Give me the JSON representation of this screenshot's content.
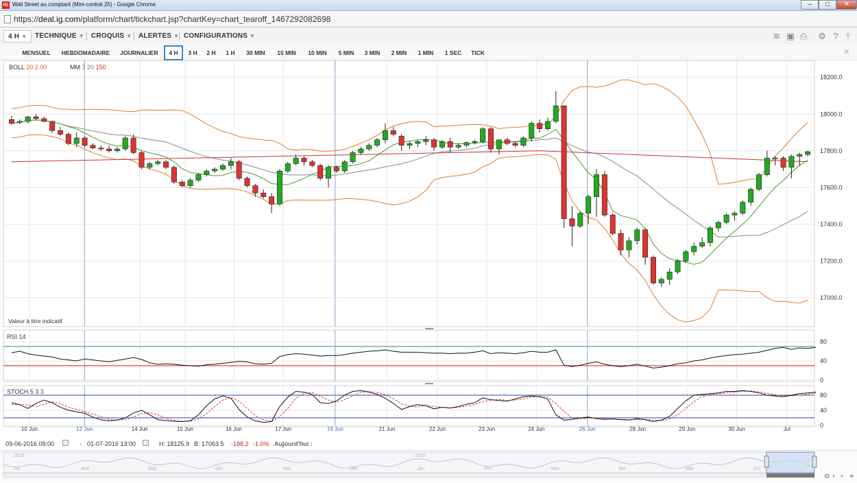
{
  "window": {
    "title": "Wall Street au comptant (Mini-contrat 25) - Google Chrome",
    "app_icon_text": "IG",
    "min": "–",
    "max": "□",
    "close": "✕"
  },
  "address": {
    "scheme": "https://",
    "host": "deal.ig.com",
    "path": "/platform/chart/tickchart.jsp?chartKey=chart_tearoff_1467292082698"
  },
  "toolbar": {
    "period": "4 H",
    "technique": "TECHNIQUE",
    "croquis": "CROQUIS",
    "alertes": "ALERTES",
    "configurations": "CONFIGURATIONS"
  },
  "timeframes": [
    "MENSUEL",
    "HEBDOMADAIRE",
    "JOURNALIER",
    "4 H",
    "3 H",
    "2 H",
    "1 H",
    "30 MIN",
    "15 MIN",
    "10 MIN",
    "5 MIN",
    "3 MIN",
    "2 MIN",
    "1 MIN",
    "1 SEC",
    "TICK"
  ],
  "selected_timeframe": "4 H",
  "indicators": {
    "boll_name": "BOLL",
    "boll_p1": "20",
    "boll_p2": "2.00",
    "mm_name": "MM",
    "mm_p1": "7",
    "mm_p2": "20",
    "mm_p3": "150",
    "rsi_name": "RSI",
    "rsi_p": "14",
    "stoch_name": "STOCH",
    "stoch_p1": "5",
    "stoch_p2": "3",
    "stoch_p3": "3",
    "note": "Valeur à titre indicatif"
  },
  "colors": {
    "up": "#22aa22",
    "down": "#dd3333",
    "boll": "#e07b2a",
    "mm7": "#4a9a2a",
    "mm20": "#888888",
    "mm150": "#cc3333",
    "rsi_hi": "#4aa7a0",
    "rsi_lo": "#e04040",
    "stoch_k": "#111111",
    "stoch_d": "#dd3333",
    "stoch_lines": "#3344aa",
    "grid": "#e6e6e6"
  },
  "footer": {
    "start": "09-06-2016 09:00",
    "dash": "-",
    "end": "01-07-2016 13:00",
    "high": "H: 18125.9",
    "low": "B: 17063.5",
    "change": "-188.2",
    "change_pct": "-1.0%",
    "today": "Aujourd'hui :"
  },
  "navigator": {
    "years": [
      "2015",
      "2016"
    ],
    "months": [
      "Jul",
      "Aoû",
      "Sep",
      "Oct",
      "Nov",
      "Déc",
      "Jan",
      "Fév",
      "Mar",
      "Avr",
      "Mai",
      "Jun"
    ]
  },
  "chart_data": {
    "type": "candlestick",
    "price_ticks": [
      "18200.0",
      "18000.0",
      "17800.0",
      "17600.0",
      "17400.0",
      "17200.0",
      "17000.0"
    ],
    "rsi_ticks": [
      "80",
      "40",
      "0"
    ],
    "stoch_ticks": [
      "80",
      "40",
      "0"
    ],
    "x_labels": [
      "10 Jun",
      "12 Jun",
      "14 Jun",
      "15 Jun",
      "16 Jun",
      "17 Jun",
      "19 Jun",
      "21 Jun",
      "22 Jun",
      "23 Jun",
      "24 Jun",
      "26 Jun",
      "28 Jun",
      "29 Jun",
      "30 Jun",
      "Jul"
    ],
    "ylim": [
      16850,
      18270
    ],
    "candles": [
      [
        17970,
        17990,
        17940,
        17950
      ],
      [
        17955,
        17970,
        17945,
        17960
      ],
      [
        17960,
        17990,
        17950,
        17985
      ],
      [
        17985,
        18000,
        17970,
        17975
      ],
      [
        17975,
        17985,
        17955,
        17960
      ],
      [
        17960,
        17965,
        17900,
        17910
      ],
      [
        17910,
        17930,
        17880,
        17890
      ],
      [
        17890,
        17900,
        17830,
        17840
      ],
      [
        17840,
        17900,
        17820,
        17870
      ],
      [
        17870,
        17880,
        17820,
        17830
      ],
      [
        17830,
        17840,
        17810,
        17815
      ],
      [
        17815,
        17830,
        17800,
        17810
      ],
      [
        17810,
        17830,
        17790,
        17800
      ],
      [
        17800,
        17820,
        17790,
        17810
      ],
      [
        17810,
        17880,
        17800,
        17870
      ],
      [
        17870,
        17890,
        17780,
        17790
      ],
      [
        17790,
        17800,
        17700,
        17710
      ],
      [
        17710,
        17740,
        17700,
        17730
      ],
      [
        17730,
        17750,
        17720,
        17740
      ],
      [
        17740,
        17750,
        17700,
        17710
      ],
      [
        17710,
        17720,
        17620,
        17630
      ],
      [
        17630,
        17640,
        17600,
        17610
      ],
      [
        17610,
        17650,
        17600,
        17640
      ],
      [
        17640,
        17680,
        17630,
        17670
      ],
      [
        17670,
        17700,
        17660,
        17690
      ],
      [
        17690,
        17710,
        17680,
        17700
      ],
      [
        17700,
        17730,
        17690,
        17720
      ],
      [
        17720,
        17760,
        17700,
        17740
      ],
      [
        17740,
        17750,
        17640,
        17650
      ],
      [
        17650,
        17660,
        17600,
        17610
      ],
      [
        17610,
        17620,
        17550,
        17570
      ],
      [
        17570,
        17590,
        17540,
        17550
      ],
      [
        17550,
        17570,
        17460,
        17510
      ],
      [
        17510,
        17700,
        17500,
        17690
      ],
      [
        17690,
        17740,
        17680,
        17730
      ],
      [
        17730,
        17780,
        17720,
        17760
      ],
      [
        17760,
        17770,
        17720,
        17740
      ],
      [
        17740,
        17750,
        17710,
        17720
      ],
      [
        17720,
        17730,
        17640,
        17650
      ],
      [
        17650,
        17720,
        17600,
        17710
      ],
      [
        17710,
        17720,
        17680,
        17690
      ],
      [
        17690,
        17750,
        17680,
        17740
      ],
      [
        17740,
        17800,
        17730,
        17790
      ],
      [
        17790,
        17820,
        17780,
        17810
      ],
      [
        17810,
        17840,
        17800,
        17830
      ],
      [
        17830,
        17870,
        17820,
        17860
      ],
      [
        17860,
        17950,
        17840,
        17910
      ],
      [
        17910,
        17930,
        17880,
        17890
      ],
      [
        17880,
        17890,
        17800,
        17830
      ],
      [
        17830,
        17850,
        17810,
        17840
      ],
      [
        17840,
        17860,
        17820,
        17850
      ],
      [
        17850,
        17880,
        17830,
        17860
      ],
      [
        17860,
        17870,
        17800,
        17820
      ],
      [
        17820,
        17860,
        17810,
        17850
      ],
      [
        17850,
        17870,
        17790,
        17820
      ],
      [
        17820,
        17840,
        17810,
        17830
      ],
      [
        17830,
        17850,
        17820,
        17845
      ],
      [
        17845,
        17860,
        17835,
        17850
      ],
      [
        17850,
        17930,
        17840,
        17920
      ],
      [
        17920,
        17930,
        17790,
        17810
      ],
      [
        17810,
        17860,
        17780,
        17860
      ],
      [
        17860,
        17870,
        17830,
        17840
      ],
      [
        17840,
        17850,
        17820,
        17830
      ],
      [
        17830,
        17880,
        17820,
        17870
      ],
      [
        17870,
        17960,
        17850,
        17950
      ],
      [
        17950,
        17970,
        17900,
        17920
      ],
      [
        17920,
        17980,
        17910,
        17960
      ],
      [
        17960,
        18125,
        17950,
        18045
      ],
      [
        18045,
        18045,
        17380,
        17430
      ],
      [
        17430,
        17500,
        17280,
        17390
      ],
      [
        17390,
        17470,
        17380,
        17460
      ],
      [
        17460,
        17560,
        17400,
        17550
      ],
      [
        17550,
        17700,
        17440,
        17670
      ],
      [
        17670,
        17690,
        17440,
        17450
      ],
      [
        17450,
        17460,
        17340,
        17350
      ],
      [
        17350,
        17370,
        17230,
        17260
      ],
      [
        17260,
        17330,
        17220,
        17310
      ],
      [
        17310,
        17380,
        17290,
        17370
      ],
      [
        17370,
        17380,
        17180,
        17220
      ],
      [
        17220,
        17230,
        17070,
        17080
      ],
      [
        17080,
        17110,
        17060,
        17100
      ],
      [
        17100,
        17160,
        17070,
        17140
      ],
      [
        17140,
        17210,
        17130,
        17200
      ],
      [
        17200,
        17260,
        17190,
        17250
      ],
      [
        17250,
        17300,
        17230,
        17280
      ],
      [
        17280,
        17330,
        17270,
        17300
      ],
      [
        17300,
        17390,
        17280,
        17380
      ],
      [
        17380,
        17420,
        17360,
        17410
      ],
      [
        17410,
        17460,
        17400,
        17450
      ],
      [
        17450,
        17470,
        17420,
        17460
      ],
      [
        17460,
        17530,
        17450,
        17520
      ],
      [
        17520,
        17600,
        17500,
        17590
      ],
      [
        17590,
        17680,
        17580,
        17670
      ],
      [
        17670,
        17800,
        17660,
        17760
      ],
      [
        17760,
        17770,
        17720,
        17760
      ],
      [
        17760,
        17770,
        17690,
        17710
      ],
      [
        17710,
        17780,
        17650,
        17770
      ],
      [
        17770,
        17790,
        17720,
        17780
      ],
      [
        17780,
        17800,
        17770,
        17795
      ]
    ],
    "mm150": [
      17740,
      17800
    ],
    "rsi": [
      57,
      60,
      55,
      52,
      50,
      48,
      44,
      42,
      40,
      44,
      42,
      40,
      38,
      41,
      44,
      47,
      43,
      36,
      33,
      34,
      33,
      31,
      30,
      29,
      32,
      33,
      35,
      37,
      39,
      38,
      34,
      33,
      35,
      49,
      53,
      55,
      54,
      52,
      50,
      51,
      51,
      53,
      56,
      58,
      60,
      61,
      63,
      60,
      58,
      58,
      58,
      57,
      56,
      56,
      55,
      56,
      56,
      58,
      61,
      55,
      57,
      56,
      55,
      57,
      60,
      58,
      58,
      63,
      31,
      28,
      31,
      35,
      38,
      33,
      30,
      28,
      30,
      33,
      29,
      25,
      27,
      30,
      34,
      36,
      40,
      42,
      46,
      49,
      51,
      53,
      54,
      56,
      58,
      62,
      66,
      68,
      64,
      67,
      66,
      68
    ],
    "stoch_k": [
      60,
      55,
      45,
      58,
      67,
      60,
      48,
      40,
      36,
      32,
      22,
      15,
      12,
      14,
      20,
      33,
      40,
      28,
      15,
      13,
      11,
      10,
      12,
      28,
      52,
      70,
      78,
      72,
      42,
      22,
      12,
      8,
      10,
      50,
      75,
      90,
      88,
      82,
      60,
      58,
      65,
      80,
      90,
      92,
      88,
      82,
      72,
      58,
      42,
      50,
      55,
      52,
      44,
      48,
      46,
      50,
      56,
      60,
      73,
      68,
      66,
      64,
      70,
      76,
      78,
      76,
      70,
      28,
      14,
      16,
      20,
      22,
      18,
      16,
      17,
      15,
      14,
      18,
      15,
      10,
      14,
      24,
      45,
      65,
      80,
      82,
      84,
      86,
      90,
      90,
      92,
      90,
      86,
      80,
      78,
      76,
      80,
      84,
      86,
      88
    ],
    "stoch_d": [
      55,
      56,
      54,
      50,
      56,
      62,
      58,
      48,
      42,
      36,
      30,
      23,
      16,
      14,
      15,
      22,
      31,
      34,
      28,
      19,
      13,
      11,
      11,
      17,
      31,
      50,
      67,
      74,
      64,
      45,
      26,
      15,
      10,
      23,
      45,
      72,
      85,
      87,
      77,
      67,
      61,
      68,
      78,
      88,
      90,
      87,
      81,
      71,
      57,
      50,
      49,
      53,
      50,
      48,
      46,
      48,
      51,
      55,
      63,
      67,
      69,
      66,
      67,
      70,
      75,
      77,
      75,
      58,
      37,
      19,
      17,
      19,
      20,
      18,
      17,
      16,
      15,
      16,
      16,
      14,
      13,
      17,
      28,
      45,
      63,
      76,
      82,
      84,
      86,
      88,
      90,
      91,
      89,
      85,
      81,
      78,
      78,
      80,
      83,
      86
    ],
    "rsi_levels": [
      70,
      30
    ],
    "stoch_levels": [
      80,
      20
    ],
    "ohlc_order": "open, high, low, close"
  }
}
